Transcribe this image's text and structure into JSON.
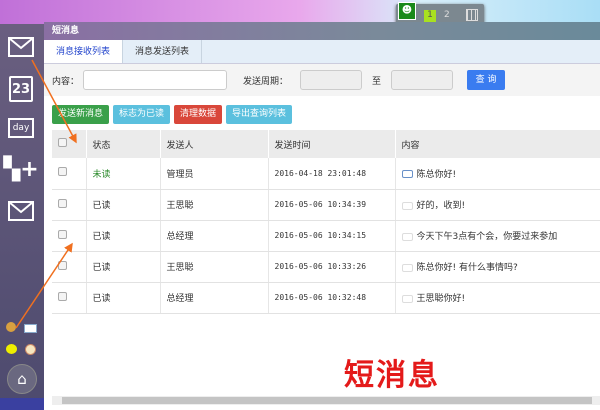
{
  "window": {
    "title": "短消息"
  },
  "dock": {
    "pages": [
      "1",
      "2"
    ],
    "active_page": "1"
  },
  "tabs": [
    {
      "label": "消息接收列表",
      "active": true
    },
    {
      "label": "消息发送列表",
      "active": false
    }
  ],
  "search": {
    "content_label": "内容：",
    "content_value": "",
    "period_label": "发送周期：",
    "to_label": "至",
    "query_label": "查 询"
  },
  "actions": [
    {
      "label": "发送新消息",
      "color": "#3aa04a"
    },
    {
      "label": "标志为已读",
      "color": "#5bc0de"
    },
    {
      "label": "清理数据",
      "color": "#d9473a"
    },
    {
      "label": "导出查询列表",
      "color": "#5bc0de"
    }
  ],
  "table": {
    "headers": [
      "状态",
      "发送人",
      "发送时间",
      "内容"
    ],
    "rows": [
      {
        "status": "未读",
        "sender": "管理员",
        "time": "2016-04-18 23:01:48",
        "content": "陈总你好!"
      },
      {
        "status": "已读",
        "sender": "王思聪",
        "time": "2016-05-06 10:34:39",
        "content": "好的，收到!"
      },
      {
        "status": "已读",
        "sender": "总经理",
        "time": "2016-05-06 10:34:15",
        "content": "今天下午3点有个会，你要过来参加"
      },
      {
        "status": "已读",
        "sender": "王思聪",
        "time": "2016-05-06 10:33:26",
        "content": "陈总你好! 有什么事情吗?"
      },
      {
        "status": "已读",
        "sender": "总经理",
        "time": "2016-05-06 10:32:48",
        "content": "王思聪你好!"
      }
    ]
  },
  "annotation": "短消息",
  "sidebar": {
    "calendar_day": "23",
    "day_label": "day"
  },
  "colors": {
    "unread": "#2a8a2a",
    "annotation": "#e41a1a",
    "arrow": "#f07020"
  }
}
